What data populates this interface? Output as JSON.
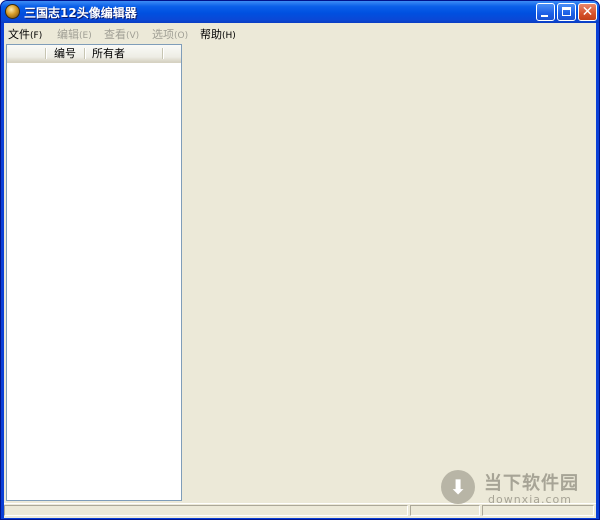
{
  "window": {
    "title": "三国志12头像编辑器",
    "controls": {
      "minimize": "minimize-icon",
      "maximize": "maximize-icon",
      "close": "close-icon"
    }
  },
  "menu": [
    {
      "label": "文件",
      "accel": "(F)",
      "enabled": true
    },
    {
      "label": "编辑",
      "accel": "(E)",
      "enabled": false
    },
    {
      "label": "查看",
      "accel": "(V)",
      "enabled": false
    },
    {
      "label": "选项",
      "accel": "(O)",
      "enabled": false
    },
    {
      "label": "帮助",
      "accel": "(H)",
      "enabled": true
    }
  ],
  "list": {
    "columns": [
      "",
      "编号",
      "所有者"
    ],
    "rows": []
  },
  "watermark": {
    "brand_cn": "当下软件园",
    "brand_en": "downxia.com",
    "icon": "download-arrow-icon"
  },
  "colors": {
    "titlebar": "#0050e0",
    "client_bg": "#ece9d8",
    "close_button": "#d6512a"
  }
}
